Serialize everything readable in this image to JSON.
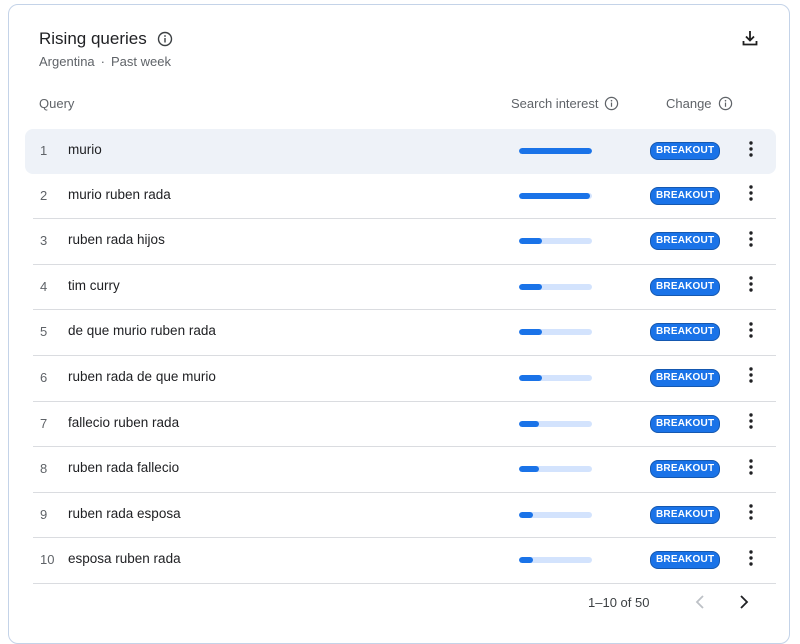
{
  "header": {
    "title": "Rising queries",
    "location": "Argentina",
    "separator": "·",
    "period": "Past week"
  },
  "columns": {
    "query": "Query",
    "search_interest": "Search interest",
    "change": "Change"
  },
  "rows": [
    {
      "num": "1",
      "query": "murio",
      "interest": 1.0,
      "change": "BREAKOUT"
    },
    {
      "num": "2",
      "query": "murio ruben rada",
      "interest": 0.97,
      "change": "BREAKOUT"
    },
    {
      "num": "3",
      "query": "ruben rada hijos",
      "interest": 0.32,
      "change": "BREAKOUT"
    },
    {
      "num": "4",
      "query": "tim curry",
      "interest": 0.32,
      "change": "BREAKOUT"
    },
    {
      "num": "5",
      "query": "de que murio ruben rada",
      "interest": 0.32,
      "change": "BREAKOUT"
    },
    {
      "num": "6",
      "query": "ruben rada de que murio",
      "interest": 0.32,
      "change": "BREAKOUT"
    },
    {
      "num": "7",
      "query": "fallecio ruben rada",
      "interest": 0.27,
      "change": "BREAKOUT"
    },
    {
      "num": "8",
      "query": "ruben rada fallecio",
      "interest": 0.27,
      "change": "BREAKOUT"
    },
    {
      "num": "9",
      "query": "ruben rada esposa",
      "interest": 0.19,
      "change": "BREAKOUT"
    },
    {
      "num": "10",
      "query": "esposa ruben rada",
      "interest": 0.19,
      "change": "BREAKOUT"
    }
  ],
  "pagination": {
    "label": "1–10 of 50"
  },
  "icons": {
    "info": "info-icon",
    "download": "download-icon",
    "more": "more-vert-icon",
    "prev": "chevron-left-icon",
    "next": "chevron-right-icon"
  },
  "colors": {
    "accent": "#1a73e8",
    "bar_track": "#d3e3fd",
    "highlight_row": "#eef2f8"
  }
}
